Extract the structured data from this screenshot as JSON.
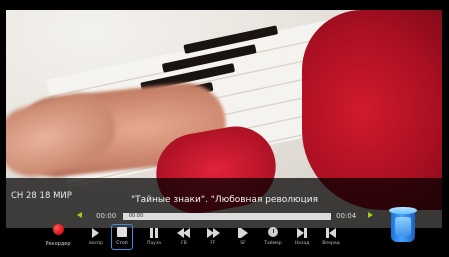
{
  "channel": {
    "label": "СН 28 18 МИР"
  },
  "program": {
    "title": "\"Тайные знаки\". \"Любовная революция"
  },
  "timeline": {
    "current_time": "00:00",
    "end_time": "00:04",
    "bar_label": "00:00",
    "progress_fraction": 1.0
  },
  "record": {
    "label": "Рекордер"
  },
  "controls": [
    {
      "name": "play-button",
      "icon": "play-icon",
      "label": "воспр"
    },
    {
      "name": "stop-button",
      "icon": "stop-icon",
      "label": "Стоп",
      "selected": true
    },
    {
      "name": "pause-button",
      "icon": "pause-icon",
      "label": "Пауза"
    },
    {
      "name": "rewind-button",
      "icon": "rewind-icon",
      "label": "FB"
    },
    {
      "name": "fast-forward-button",
      "icon": "fast-forward-icon",
      "label": "FF"
    },
    {
      "name": "slow-button",
      "icon": "slow-play-icon",
      "label": "SF"
    },
    {
      "name": "timer-button",
      "icon": "clock-icon",
      "label": "Таймер"
    },
    {
      "name": "next-button",
      "icon": "skip-next-icon",
      "label": "Назад"
    },
    {
      "name": "previous-button",
      "icon": "skip-previous-icon",
      "label": "Вперед"
    }
  ],
  "colors": {
    "accent_selection": "#3e8fe0",
    "arrow_green": "#9bd11a",
    "record_red": "#e01818"
  }
}
